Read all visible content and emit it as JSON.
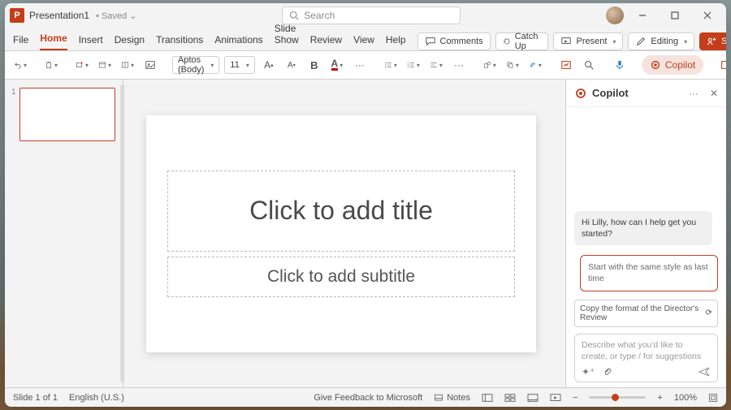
{
  "titlebar": {
    "app_letter": "P",
    "doc_name": "Presentation1",
    "save_state": "• Saved ⌄",
    "search_placeholder": "Search"
  },
  "menu": {
    "tabs": [
      "File",
      "Home",
      "Insert",
      "Design",
      "Transitions",
      "Animations",
      "Slide Show",
      "Review",
      "View",
      "Help"
    ],
    "active": 1,
    "comments": "Comments",
    "catchup": "Catch Up",
    "present": "Present",
    "editing": "Editing",
    "share": "Share"
  },
  "ribbon": {
    "font": "Aptos (Body)",
    "size": "11",
    "copilot": "Copilot"
  },
  "thumbs": {
    "num": "1"
  },
  "slide": {
    "title_ph": "Click to add title",
    "sub_ph": "Click to add subtitle"
  },
  "copilot": {
    "title": "Copilot",
    "bot_msg": "Hi Lilly, how can I help get you started?",
    "user_msg": "Start with the same style as last time",
    "suggest": "Copy the format of the Director's Review",
    "input_ph": "Describe what you'd like to create, or type / for suggestions"
  },
  "status": {
    "slide": "Slide 1 of 1",
    "lang": "English (U.S.)",
    "feedback": "Give Feedback to Microsoft",
    "notes": "Notes",
    "zoom": "100%"
  }
}
